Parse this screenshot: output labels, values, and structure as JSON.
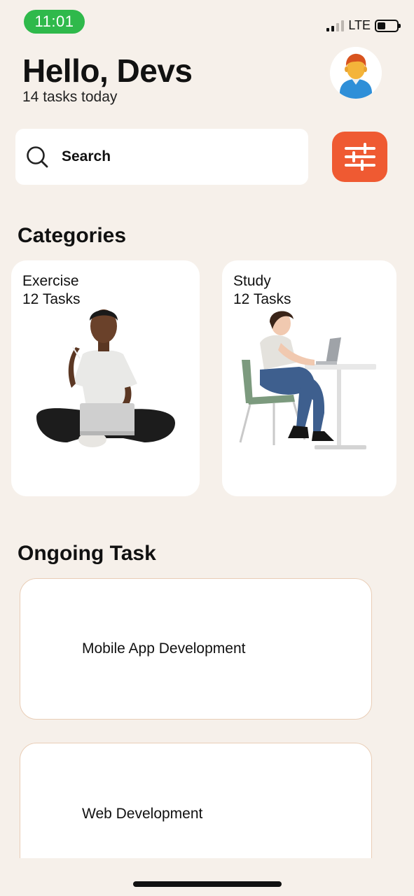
{
  "status_bar": {
    "time": "11:01",
    "network": "LTE",
    "signal_bars": 4,
    "signal_bars_active": 2
  },
  "header": {
    "greeting": "Hello, Devs",
    "subtitle": "14 tasks today",
    "avatar_icon": "person-avatar-icon"
  },
  "search": {
    "placeholder": "Search",
    "icon": "search-icon",
    "filter_icon": "sliders-icon",
    "filter_color": "#ef5a32"
  },
  "categories": {
    "title": "Categories",
    "items": [
      {
        "name": "Exercise",
        "count": "12 Tasks",
        "illustration": "person-with-laptop-sitting-illustration"
      },
      {
        "name": "Study",
        "count": "12 Tasks",
        "illustration": "person-at-desk-illustration"
      }
    ]
  },
  "ongoing": {
    "title": "Ongoing Task",
    "items": [
      {
        "title": "Mobile App Development"
      },
      {
        "title": "Web Development"
      }
    ]
  },
  "colors": {
    "background": "#f6f0ea",
    "accent": "#ef5a32",
    "status_green": "#2fb94b",
    "card_border": "#e9cdb6"
  }
}
